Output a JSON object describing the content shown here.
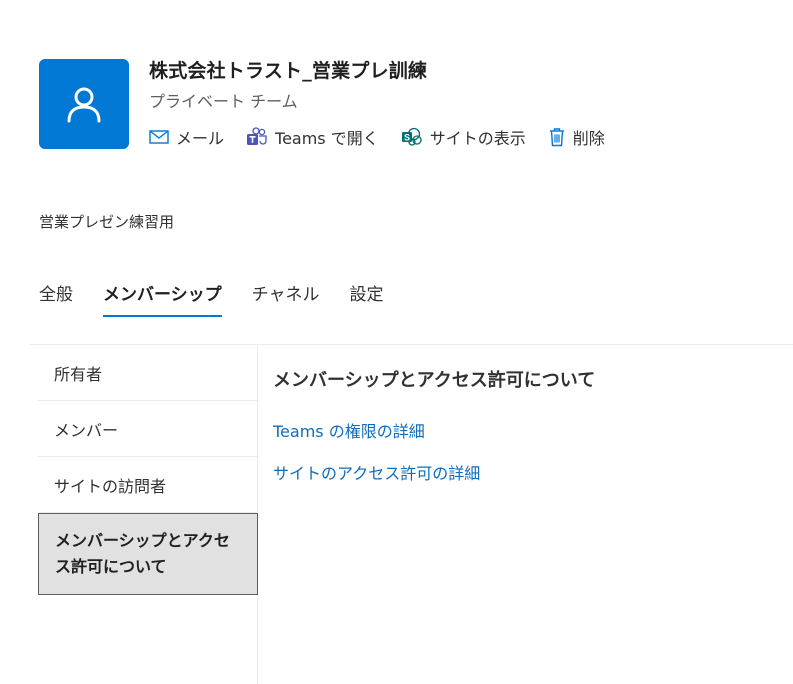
{
  "header": {
    "team_name": "株式会社トラスト_営業プレ訓練",
    "team_type": "プライベート チーム",
    "avatar_icon": "person-icon",
    "accent_color": "#0078d4"
  },
  "actions": [
    {
      "label": "メール",
      "icon": "mail-icon"
    },
    {
      "label": "Teams で開く",
      "icon": "teams-icon"
    },
    {
      "label": "サイトの表示",
      "icon": "sharepoint-icon"
    },
    {
      "label": "削除",
      "icon": "trash-icon"
    }
  ],
  "description": "営業プレゼン練習用",
  "tabs": [
    {
      "label": "全般",
      "active": false
    },
    {
      "label": "メンバーシップ",
      "active": true
    },
    {
      "label": "チャネル",
      "active": false
    },
    {
      "label": "設定",
      "active": false
    }
  ],
  "leftnav": [
    {
      "label": "所有者"
    },
    {
      "label": "メンバー"
    },
    {
      "label": "サイトの訪問者"
    },
    {
      "label": "メンバーシップとアクセス許可について",
      "selected": true
    }
  ],
  "content": {
    "title": "メンバーシップとアクセス許可について",
    "links": [
      "Teams の権限の詳細",
      "サイトのアクセス許可の詳細"
    ]
  }
}
